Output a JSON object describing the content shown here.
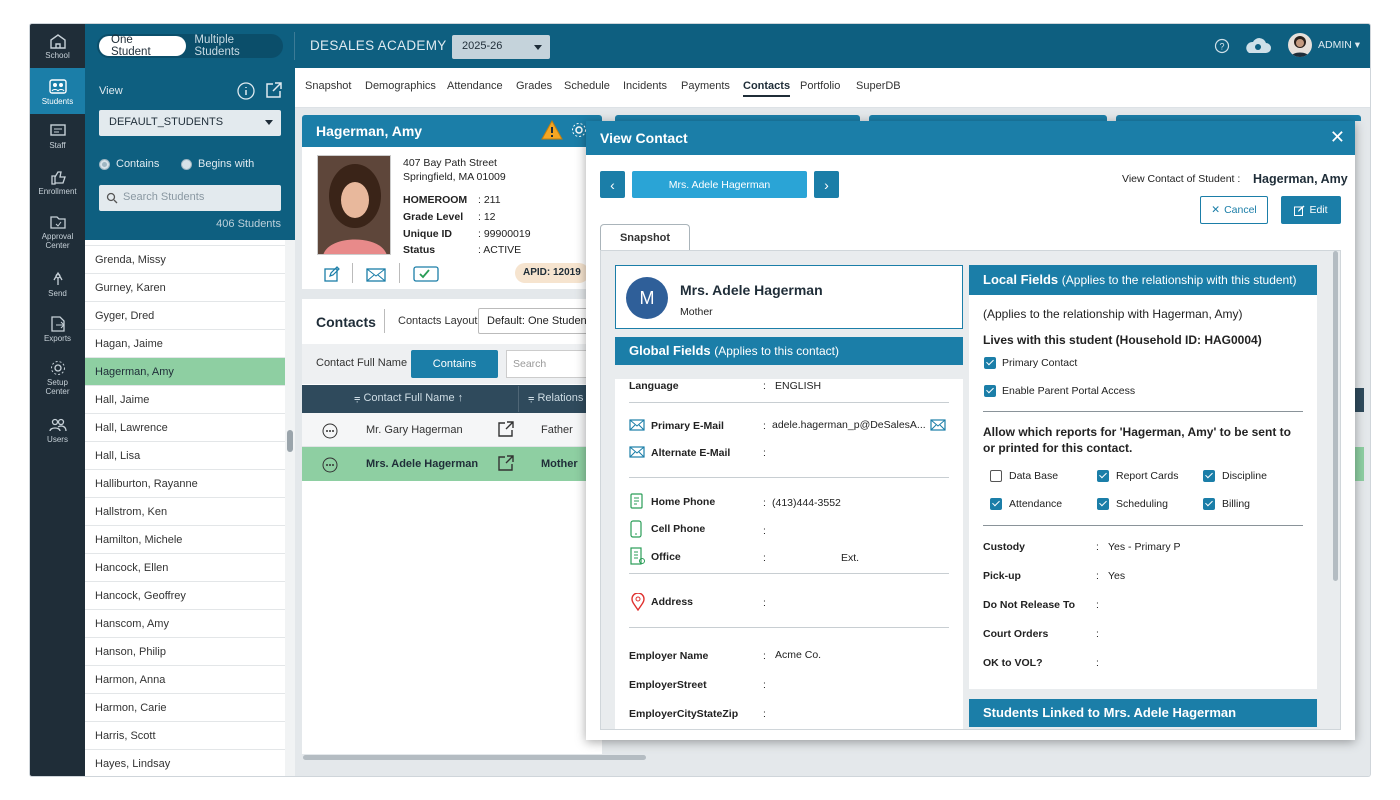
{
  "nav": [
    {
      "label": "School",
      "icon": "school-icon"
    },
    {
      "label": "Students",
      "icon": "students-icon"
    },
    {
      "label": "Staff",
      "icon": "staff-icon"
    },
    {
      "label": "Enrollment",
      "icon": "enrollment-icon"
    },
    {
      "label": "Approval Center",
      "icon": "approval-icon"
    },
    {
      "label": "Send",
      "icon": "send-icon"
    },
    {
      "label": "Exports",
      "icon": "exports-icon"
    },
    {
      "label": "Setup Center",
      "icon": "setup-icon"
    },
    {
      "label": "Users",
      "icon": "users-icon"
    }
  ],
  "topbar": {
    "toggle_on": "One Student",
    "toggle_off": "Multiple Students",
    "school": "DESALES ACADEMY",
    "year": "2025-26",
    "user": "ADMIN"
  },
  "left": {
    "view_label": "View",
    "view_value": "DEFAULT_STUDENTS",
    "contains": "Contains",
    "begins": "Begins with",
    "search_placeholder": "Search Students",
    "count": "406 Students",
    "students": [
      "Grenda, Missy",
      "Gurney, Karen",
      "Gyger, Dred",
      "Hagan, Jaime",
      "Hagerman, Amy",
      "Hall, Jaime",
      "Hall, Lawrence",
      "Hall, Lisa",
      "Halliburton, Rayanne",
      "Hallstrom, Ken",
      "Hamilton, Michele",
      "Hancock, Ellen",
      "Hancock, Geoffrey",
      "Hanscom, Amy",
      "Hanson, Philip",
      "Harmon, Anna",
      "Harmon, Carie",
      "Harris, Scott",
      "Hayes, Lindsay"
    ]
  },
  "tabs": [
    "Snapshot",
    "Demographics",
    "Attendance",
    "Grades",
    "Schedule",
    "Incidents",
    "Payments",
    "Contacts",
    "Portfolio",
    "SuperDB"
  ],
  "student": {
    "name": "Hagerman, Amy",
    "street": "407 Bay Path Street",
    "city": "Springfield, MA 01009",
    "homeroom_label": "HOMEROOM",
    "homeroom": ": 211",
    "grade_label": "Grade Level",
    "grade": ": 12",
    "uid_label": "Unique ID",
    "uid": ": 99900019",
    "status_label": "Status",
    "status": ": ACTIVE",
    "apid": "APID: 12019"
  },
  "contacts": {
    "title": "Contacts",
    "layout_label": "Contacts Layout",
    "layout_value": "Default: One Student",
    "filter_label": "Contact Full Name",
    "filter_mode": "Contains",
    "search_placeholder": "Search",
    "col1": "Contact Full Name ↑",
    "col2": "Relations",
    "rows": [
      {
        "name": "Mr. Gary Hagerman",
        "rel": "Father"
      },
      {
        "name": "Mrs. Adele Hagerman",
        "rel": "Mother"
      }
    ]
  },
  "modal": {
    "title": "View Contact",
    "contact_name": "Mrs. Adele Hagerman",
    "view_of_label": "View Contact of Student :",
    "view_of_value": "Hagerman, Amy",
    "cancel": "Cancel",
    "edit": "Edit",
    "tab": "Snapshot",
    "initial": "M",
    "relation": "Mother",
    "global_title": "Global Fields",
    "global_sub": "(Applies to this contact)",
    "fields": {
      "language_label": "Language",
      "language": "ENGLISH",
      "email_label": "Primary E-Mail",
      "email": "adele.hagerman_p@DeSalesA...",
      "alt_email_label": "Alternate E-Mail",
      "home_label": "Home Phone",
      "home": "(413)444-3552",
      "cell_label": "Cell Phone",
      "office_label": "Office",
      "ext": "Ext.",
      "address_label": "Address",
      "employer_label": "Employer Name",
      "employer": "Acme Co.",
      "emp_street_label": "EmployerStreet",
      "emp_city_label": "EmployerCityStateZip"
    },
    "local_title": "Local Fields",
    "local_sub": "(Applies to the relationship with this student)",
    "local_note": "(Applies to the relationship with Hagerman, Amy)",
    "lives_with": "Lives with this student (Household ID: HAG0004)",
    "primary_contact": "Primary Contact",
    "parent_portal": "Enable Parent Portal Access",
    "reports_q": "Allow which reports for 'Hagerman, Amy' to be sent to or printed for this contact.",
    "reports": [
      {
        "label": "Data Base",
        "checked": false
      },
      {
        "label": "Report Cards",
        "checked": true
      },
      {
        "label": "Discipline",
        "checked": true
      },
      {
        "label": "Attendance",
        "checked": true
      },
      {
        "label": "Scheduling",
        "checked": true
      },
      {
        "label": "Billing",
        "checked": true
      }
    ],
    "custody_label": "Custody",
    "custody": "Yes - Primary P",
    "pickup_label": "Pick-up",
    "pickup": "Yes",
    "dnr_label": "Do Not Release To",
    "court_label": "Court Orders",
    "vol_label": "OK to VOL?",
    "linked_title": "Students Linked to Mrs. Adele Hagerman"
  },
  "colors": {
    "accent": "#1b7ea8",
    "dark": "#0e5f80",
    "nav": "#1f2d38",
    "highlight": "#8ecfa2"
  }
}
